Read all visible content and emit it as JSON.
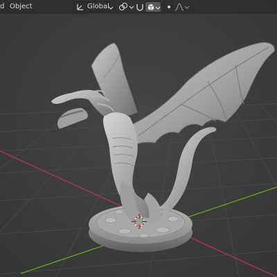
{
  "header": {
    "mode_partial": "d",
    "object_menu": "Object",
    "orientation": {
      "label": "Global",
      "icon": "transform-orientation-icon"
    },
    "pivot_icon": "pivot-point-icon",
    "snap_icon": "snap-magnet-icon",
    "snap_target_icon": "snap-target-icon",
    "proportional_icon": "proportional-editing-icon",
    "falloff_icon": "falloff-curve-icon"
  },
  "viewport": {
    "background": "#3c3c3c",
    "grid_color": "#4a4a4a",
    "x_axis_color": "#a23a48",
    "y_axis_color": "#6a9a2a",
    "object": "dragon-sculpt",
    "gizmo": "3d-cursor-icon"
  }
}
